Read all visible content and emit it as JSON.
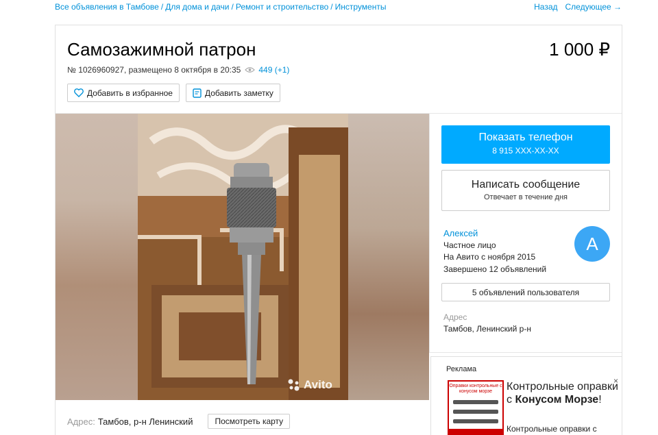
{
  "breadcrumbs": [
    "Все объявления в Тамбове",
    "Для дома и дачи",
    "Ремонт и строительство",
    "Инструменты"
  ],
  "breadcrumb_separator": "/",
  "pager": {
    "back": "Назад",
    "next": "Следующее →"
  },
  "listing": {
    "title": "Самозажимной патрон",
    "price": "1 000 ₽",
    "meta": "№ 1026960927, размещено 8 октября в 20:35",
    "views": "449 (+1)",
    "favorite_label": "Добавить в избранное",
    "note_label": "Добавить заметку"
  },
  "photo": {
    "watermark": "Avito"
  },
  "address_bar": {
    "label": "Адрес:",
    "value": "Тамбов, р-н Ленинский",
    "map_button": "Посмотреть карту"
  },
  "contact": {
    "phone_title": "Показать телефон",
    "phone_masked": "8 915 XXX-XX-XX",
    "message_title": "Написать сообщение",
    "message_sub": "Отвечает в течение дня"
  },
  "seller": {
    "name": "Алексей",
    "type": "Частное лицо",
    "since": "На Авито с ноября 2015",
    "completed": "Завершено 12 объявлений",
    "avatar_letter": "A",
    "ads_button": "5 объявлений пользователя",
    "address_label": "Адрес",
    "address_value": "Тамбов, Ленинский р-н"
  },
  "ad": {
    "label": "Реклама",
    "close": "×",
    "thumb_text": "Оправки контрольные с конусом морзе",
    "title_plain1": "Контрольные оправки с ",
    "title_bold1": "Конусом Морзе",
    "title_plain2": "!",
    "text": "Контрольные оправки с"
  },
  "colors": {
    "link": "#0091d9",
    "phone_button": "#00aaff",
    "avatar": "#3ca7f5"
  },
  "icons": {
    "favorite": "heart-icon",
    "note": "note-icon",
    "views": "eye-icon",
    "watermark": "avito-dots-icon"
  }
}
